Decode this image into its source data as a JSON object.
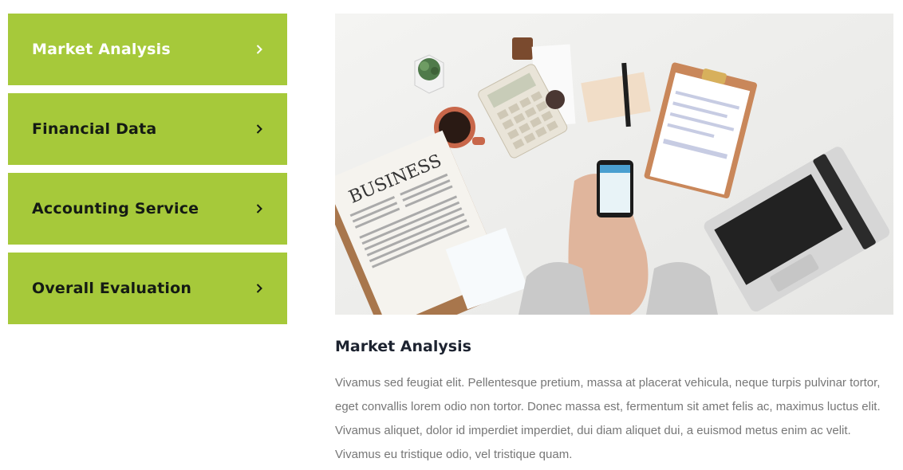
{
  "tabs": [
    {
      "label": "Market Analysis",
      "active": true,
      "icon": "chevron-right-icon"
    },
    {
      "label": "Financial Data",
      "active": false,
      "icon": "chevron-right-icon"
    },
    {
      "label": "Accounting Service",
      "active": false,
      "icon": "chevron-right-icon"
    },
    {
      "label": "Overall Evaluation",
      "active": false,
      "icon": "chevron-right-icon"
    }
  ],
  "content": {
    "title": "Market Analysis",
    "text": "Vivamus sed feugiat elit. Pellentesque pretium, massa at placerat vehicula, neque turpis pulvinar tortor, eget convallis lorem odio non tortor. Donec massa est, fermentum sit amet felis ac, maximus luctus elit. Vivamus aliquet, dolor id imperdiet imperdiet, dui diam aliquet dui, a euismod metus enim ac velit. Vivamus eu tristique odio, vel tristique quam."
  },
  "newspaper": {
    "headline": "BUSINESS"
  },
  "colors": {
    "accent": "#a6c93a",
    "active_text": "#ffffff",
    "tab_text": "#141a14",
    "body_text": "#777777",
    "title_text": "#1d2330"
  }
}
